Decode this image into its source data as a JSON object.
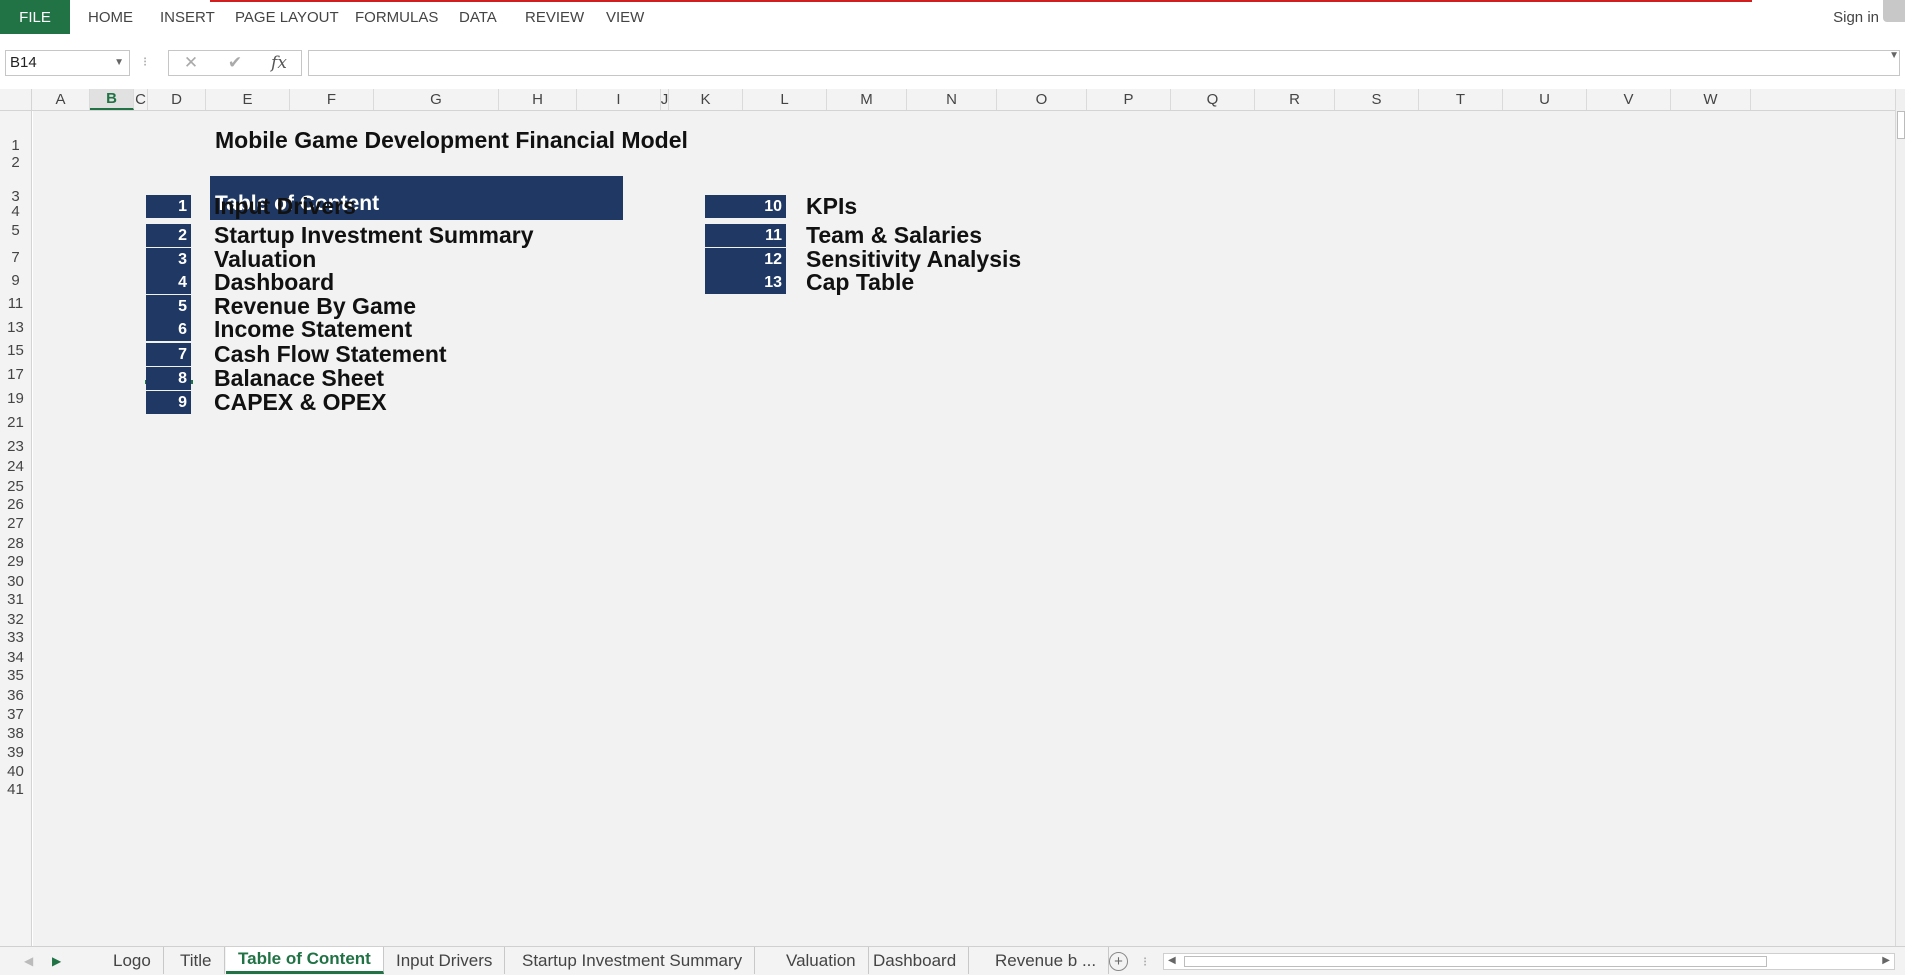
{
  "ribbon": {
    "file": "FILE",
    "tabs": [
      "HOME",
      "INSERT",
      "PAGE LAYOUT",
      "FORMULAS",
      "DATA",
      "REVIEW",
      "VIEW"
    ],
    "sign_in": "Sign in"
  },
  "formula_bar": {
    "name_box": "B14",
    "cancel_icon": "✕",
    "enter_icon": "✔",
    "fx": "fx",
    "value": ""
  },
  "columns": [
    "A",
    "B",
    "C",
    "D",
    "E",
    "F",
    "G",
    "H",
    "I",
    "J",
    "K",
    "L",
    "M",
    "N",
    "O",
    "P",
    "Q",
    "R",
    "S",
    "T",
    "U",
    "V",
    "W"
  ],
  "active_column": "B",
  "rows": [
    "1",
    "2",
    "3",
    "4",
    "5",
    "7",
    "9",
    "11",
    "13",
    "15",
    "17",
    "19",
    "21",
    "23",
    "24",
    "25",
    "26",
    "27",
    "28",
    "29",
    "30",
    "31",
    "32",
    "33",
    "34",
    "35",
    "36",
    "37",
    "38",
    "39",
    "40",
    "41"
  ],
  "sheet": {
    "title": "Mobile Game Development Financial Model",
    "toc_header": "Table of Content",
    "left_items": [
      {
        "num": "1",
        "label": "Input Drivers"
      },
      {
        "num": "2",
        "label": "Startup Investment Summary"
      },
      {
        "num": "3",
        "label": "Valuation"
      },
      {
        "num": "4",
        "label": "Dashboard"
      },
      {
        "num": "5",
        "label": "Revenue By Game"
      },
      {
        "num": "6",
        "label": "Income Statement"
      },
      {
        "num": "7",
        "label": "Cash Flow Statement"
      },
      {
        "num": "8",
        "label": "Balanace Sheet"
      },
      {
        "num": "9",
        "label": "CAPEX & OPEX"
      }
    ],
    "right_items": [
      {
        "num": "10",
        "label": "KPIs"
      },
      {
        "num": "11",
        "label": "Team & Salaries"
      },
      {
        "num": "12",
        "label": "Sensitivity Analysis"
      },
      {
        "num": "13",
        "label": "Cap Table"
      }
    ]
  },
  "sheet_tabs": [
    "Logo",
    "Title",
    "Table of Content",
    "Input Drivers",
    "Startup Investment Summary",
    "Valuation",
    "Dashboard",
    "Revenue b ..."
  ],
  "active_sheet": "Table of Content",
  "add_sheet_icon": "+",
  "colors": {
    "accent": "#217346",
    "navy": "#1f3864",
    "sheet_bg": "#f2f2f2"
  }
}
